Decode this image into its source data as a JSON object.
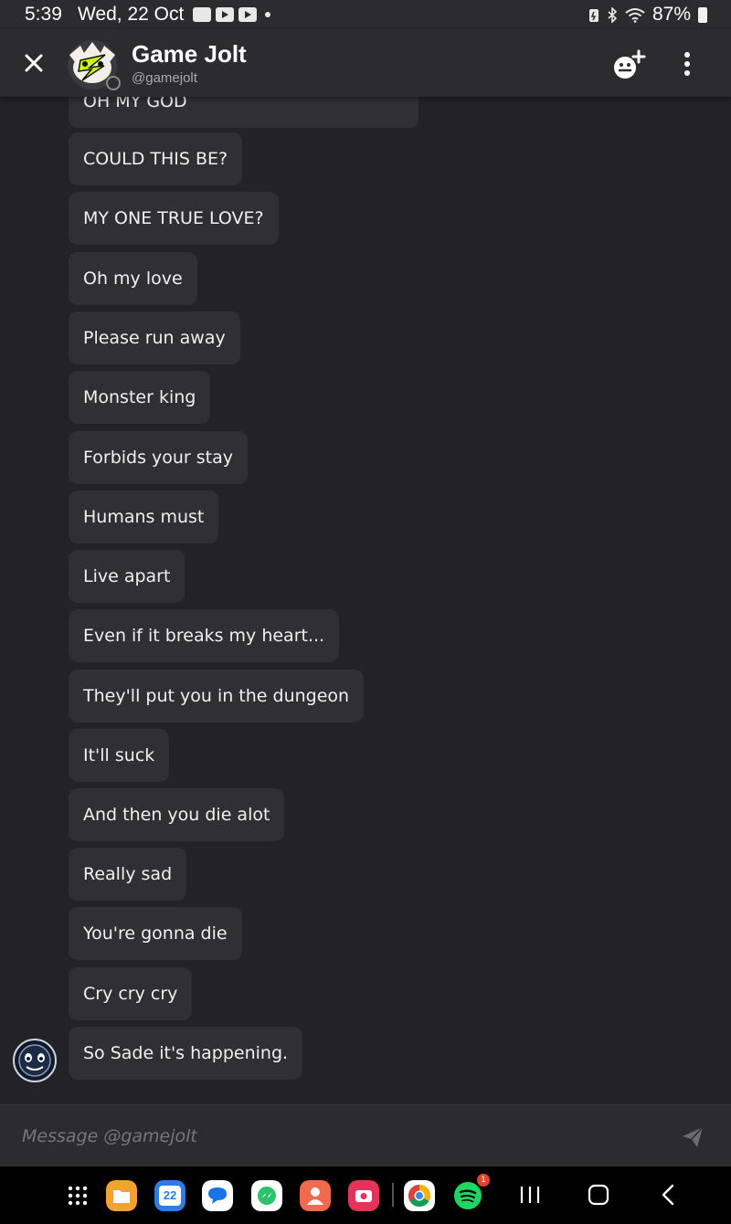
{
  "status_bar": {
    "time": "5:39",
    "date": "Wed, 22 Oct",
    "battery": "87%"
  },
  "header": {
    "title": "Game Jolt",
    "handle": "@gamejolt"
  },
  "messages": [
    "OH MY GOD",
    "COULD THIS BE?",
    "MY ONE TRUE LOVE?",
    "Oh my love",
    "Please run away",
    "Monster king",
    "Forbids your stay",
    "Humans must",
    "Live apart",
    "Even if it breaks my heart...",
    "They'll put you in the dungeon",
    "It'll suck",
    "And then you die alot",
    "Really sad",
    "You're gonna die",
    "Cry cry cry",
    "So Sade it's happening."
  ],
  "composer": {
    "placeholder": "Message @gamejolt",
    "value": ""
  },
  "navbar": {
    "calendar_day": "22",
    "spotify_badge": "1"
  },
  "colors": {
    "background": "#232226",
    "header": "#2c2b30",
    "bubble": "#302f34",
    "text": "#f0f0f0"
  }
}
